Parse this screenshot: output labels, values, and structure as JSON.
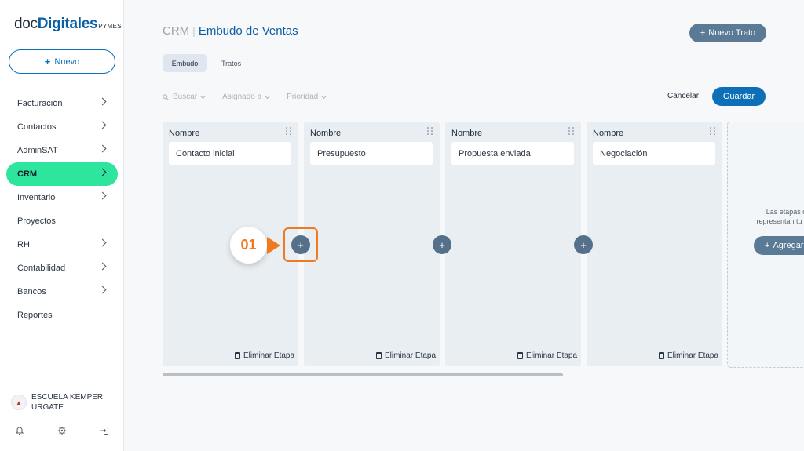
{
  "logo": {
    "doc": "doc",
    "brand": "Digitales",
    "suffix": "PYMES"
  },
  "sidebar": {
    "new_label": "Nuevo",
    "items": [
      {
        "label": "Facturación",
        "chevron": true,
        "active": false
      },
      {
        "label": "Contactos",
        "chevron": true,
        "active": false
      },
      {
        "label": "AdminSAT",
        "chevron": true,
        "active": false
      },
      {
        "label": "CRM",
        "chevron": true,
        "active": true
      },
      {
        "label": "Inventario",
        "chevron": true,
        "active": false
      },
      {
        "label": "Proyectos",
        "chevron": false,
        "active": false
      },
      {
        "label": "RH",
        "chevron": true,
        "active": false
      },
      {
        "label": "Contabilidad",
        "chevron": true,
        "active": false
      },
      {
        "label": "Bancos",
        "chevron": true,
        "active": false
      },
      {
        "label": "Reportes",
        "chevron": false,
        "active": false
      }
    ],
    "org": {
      "line1": "ESCUELA KEMPER",
      "line2": "URGATE"
    },
    "footer_icons": [
      "bell-icon",
      "gear-icon",
      "logout-icon"
    ]
  },
  "header": {
    "section": "CRM",
    "separator": "|",
    "title": "Embudo de Ventas",
    "new_deal_label": "Nuevo Trato"
  },
  "tabs": [
    {
      "label": "Embudo",
      "active": true
    },
    {
      "label": "Tratos",
      "active": false
    }
  ],
  "filters": {
    "search_placeholder": "Buscar",
    "assigned_label": "Asignado a",
    "priority_label": "Prioridad"
  },
  "actions": {
    "cancel_label": "Cancelar",
    "save_label": "Guardar"
  },
  "board": {
    "columns": [
      {
        "header": "Nombre",
        "stage": "Contacto inicial",
        "delete_label": "Eliminar Etapa"
      },
      {
        "header": "Nombre",
        "stage": "Presupuesto",
        "delete_label": "Eliminar Etapa"
      },
      {
        "header": "Nombre",
        "stage": "Propuesta enviada",
        "delete_label": "Eliminar Etapa"
      },
      {
        "header": "Nombre",
        "stage": "Negociación",
        "delete_label": "Eliminar Etapa"
      }
    ],
    "add_column": {
      "text_line1": "Las etapas del",
      "text_line2": "representan tu proce",
      "add_label": "Agregar"
    }
  },
  "tutorial": {
    "step": "01"
  },
  "colors": {
    "accent": "#0d6fb8",
    "active_nav": "#2ee59d",
    "highlight": "#f07a1f",
    "button_slate": "#5b7a95"
  }
}
